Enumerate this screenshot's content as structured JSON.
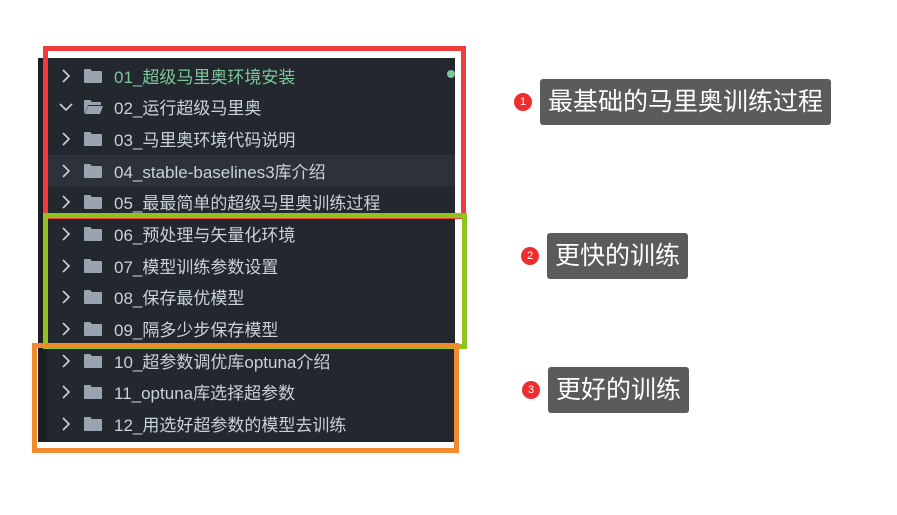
{
  "explorer": {
    "items": [
      {
        "label": "01_超级马里奥环境安装",
        "expanded": false,
        "active": true
      },
      {
        "label": "02_运行超级马里奥",
        "expanded": true,
        "active": false
      },
      {
        "label": "03_马里奥环境代码说明",
        "expanded": false,
        "active": false
      },
      {
        "label": "04_stable-baselines3库介绍",
        "expanded": false,
        "active": false
      },
      {
        "label": "05_最最简单的超级马里奥训练过程",
        "expanded": false,
        "active": false
      },
      {
        "label": "06_预处理与矢量化环境",
        "expanded": false,
        "active": false
      },
      {
        "label": "07_模型训练参数设置",
        "expanded": false,
        "active": false
      },
      {
        "label": "08_保存最优模型",
        "expanded": false,
        "active": false
      },
      {
        "label": "09_隔多少步保存模型",
        "expanded": false,
        "active": false
      },
      {
        "label": "10_超参数调优库optuna介绍",
        "expanded": false,
        "active": false
      },
      {
        "label": "11_optuna库选择超参数",
        "expanded": false,
        "active": false
      },
      {
        "label": "12_用选好超参数的模型去训练",
        "expanded": false,
        "active": false
      }
    ]
  },
  "annotations": [
    {
      "number": "1",
      "text": "最基础的马里奥训练过程",
      "box_color": "#ef3b3b"
    },
    {
      "number": "2",
      "text": "更快的训练",
      "box_color": "#8fc31f"
    },
    {
      "number": "3",
      "text": "更好的训练",
      "box_color": "#f08a2e"
    }
  ],
  "colors": {
    "panel_bg": "#23272e",
    "text": "#c9d1d9",
    "active_text": "#7ec699",
    "folder_icon": "#9aa4b1",
    "badge": "#ee2e2e",
    "tag_bg": "#5b5b5b"
  },
  "icons": {
    "collapsed": "chevron-right-icon",
    "expanded": "chevron-down-icon",
    "folder": "folder-icon",
    "open_folder": "folder-open-icon"
  }
}
